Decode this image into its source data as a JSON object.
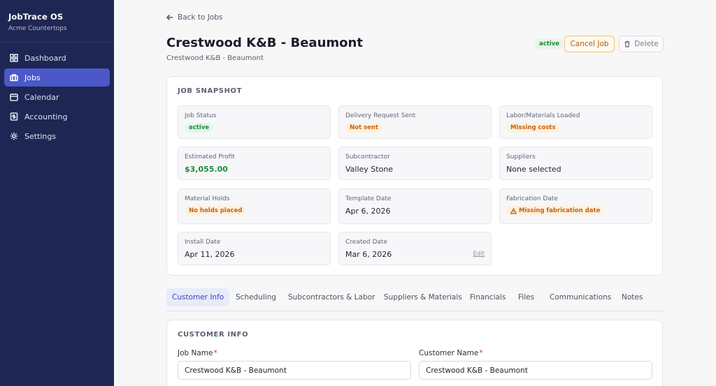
{
  "brand": {
    "name": "JobTrace OS",
    "subtitle": "Acme Countertops"
  },
  "nav": [
    {
      "label": "Dashboard",
      "icon": "grid-icon",
      "active": false
    },
    {
      "label": "Jobs",
      "icon": "briefcase-icon",
      "active": true
    },
    {
      "label": "Calendar",
      "icon": "calendar-icon",
      "active": false
    },
    {
      "label": "Accounting",
      "icon": "dollar-icon",
      "active": false
    },
    {
      "label": "Settings",
      "icon": "gear-icon",
      "active": false
    }
  ],
  "header": {
    "back_label": "Back to Jobs",
    "title": "Crestwood K&B - Beaumont",
    "subtitle": "Crestwood K&B - Beaumont",
    "status_badge": "active",
    "cancel_label": "Cancel Job",
    "delete_label": "Delete"
  },
  "snapshot": {
    "title": "JOB SNAPSHOT",
    "tiles": [
      {
        "label": "Job Status",
        "value": "active",
        "kind": "badge-green"
      },
      {
        "label": "Delivery Request Sent",
        "value": "Not sent",
        "kind": "badge-amber"
      },
      {
        "label": "Labor/Materials Loaded",
        "value": "Missing costs",
        "kind": "badge-amber"
      },
      {
        "label": "Estimated Profit",
        "value": "$3,055.00",
        "kind": "profit"
      },
      {
        "label": "Subcontractor",
        "value": "Valley Stone",
        "kind": "text"
      },
      {
        "label": "Suppliers",
        "value": "None selected",
        "kind": "text"
      },
      {
        "label": "Material Holds",
        "value": "No holds placed",
        "kind": "badge-amber"
      },
      {
        "label": "Template Date",
        "value": "Apr 6, 2026",
        "kind": "text"
      },
      {
        "label": "Fabrication Date",
        "value": "Missing fabrication date",
        "kind": "badge-amber-warn"
      },
      {
        "label": "Install Date",
        "value": "Apr 11, 2026",
        "kind": "text"
      },
      {
        "label": "Created Date",
        "value": "Mar 6, 2026",
        "kind": "text",
        "action": "Edit"
      }
    ]
  },
  "tabs": [
    {
      "label": "Customer Info",
      "active": true
    },
    {
      "label": "Scheduling",
      "active": false
    },
    {
      "label": "Subcontractors & Labor",
      "active": false
    },
    {
      "label": "Suppliers & Materials",
      "active": false
    },
    {
      "label": "Financials",
      "active": false
    },
    {
      "label": "Files",
      "active": false
    },
    {
      "label": "Communications",
      "active": false
    },
    {
      "label": "Notes",
      "active": false
    }
  ],
  "customer_info": {
    "title": "CUSTOMER INFO",
    "job_name_label": "Job Name",
    "job_name_value": "Crestwood K&B - Beaumont",
    "customer_name_label": "Customer Name",
    "customer_name_value": "Crestwood K&B - Beaumont",
    "required_mark": "*"
  },
  "colors": {
    "sidebar_bg": "#1e2654",
    "nav_active": "#4a58c8",
    "success": "#1f8a3c",
    "warning": "#c26414",
    "tab_active": "#3845b5"
  }
}
